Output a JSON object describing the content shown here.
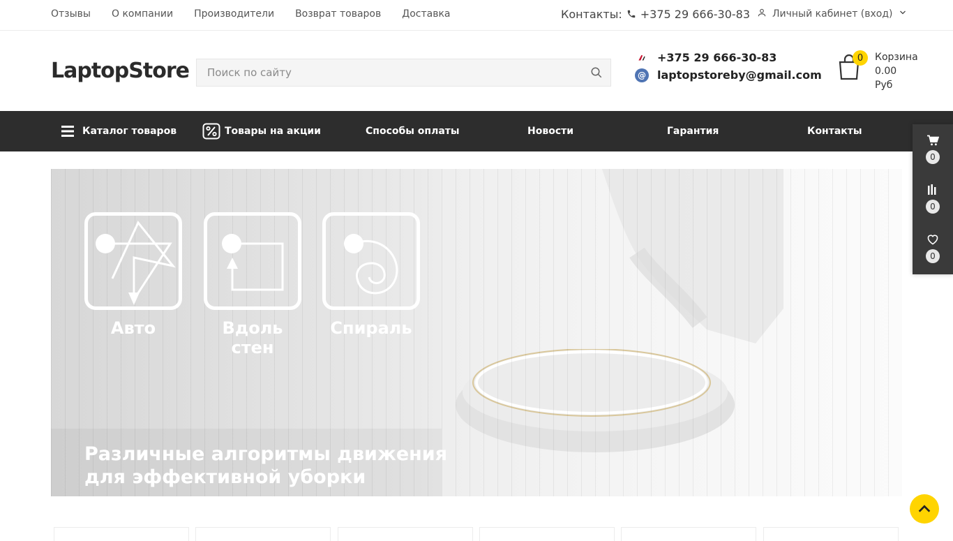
{
  "topbar": {
    "links": [
      "Отзывы",
      "О компании",
      "Производители",
      "Возврат товаров",
      "Доставка"
    ],
    "contacts_label": "Контакты:",
    "contacts_phone": "+375 29 666-30-83",
    "account_label": "Личный кабинет (вход)"
  },
  "header": {
    "logo": "LaptopStore",
    "search_placeholder": "Поиск по сайту",
    "phone": "+375 29 666-30-83",
    "email": "laptopstoreby@gmail.com",
    "cart": {
      "count": "0",
      "label": "Корзина",
      "amount": "0.00",
      "currency": "Руб"
    }
  },
  "nav": {
    "catalog": "Каталог товаров",
    "promo": "Товары на акции",
    "payment": "Способы оплаты",
    "news": "Новости",
    "warranty": "Гарантия",
    "contacts": "Контакты"
  },
  "side_panel": {
    "cart_count": "0",
    "compare_count": "0",
    "favorites_count": "0"
  },
  "banner": {
    "modes": [
      "Авто",
      "Вдоль стен",
      "Спираль"
    ],
    "title_line1": "Различные алгоритмы движения",
    "title_line2": "для эффективной уборки"
  },
  "colors": {
    "accent": "#ffd400",
    "nav_bg": "#2d2d2d",
    "panel_bg": "#3a3a3a"
  }
}
